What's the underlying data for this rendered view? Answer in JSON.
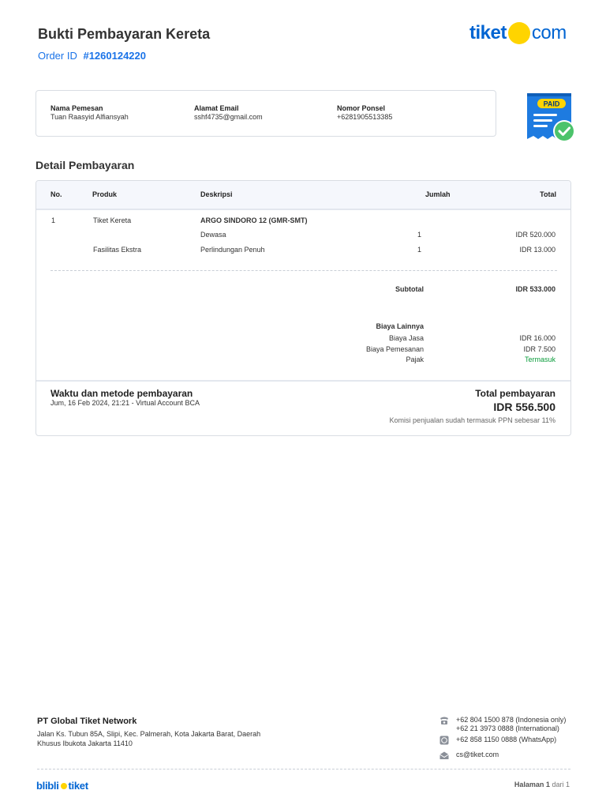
{
  "header": {
    "title": "Bukti Pembayaran Kereta",
    "order_label": "Order ID",
    "order_id": "#1260124220"
  },
  "logo": {
    "left": "tiket",
    "right": "com"
  },
  "customer": {
    "name_label": "Nama Pemesan",
    "name": "Tuan Raasyid Alfiansyah",
    "email_label": "Alamat Email",
    "email": "sshf4735@gmail.com",
    "phone_label": "Nomor Ponsel",
    "phone": "+6281905513385"
  },
  "badge": {
    "text": "PAID"
  },
  "detail": {
    "title": "Detail Pembayaran",
    "columns": {
      "no": "No.",
      "product": "Produk",
      "description": "Deskripsi",
      "qty": "Jumlah",
      "total": "Total"
    },
    "rows": [
      {
        "no": "1",
        "product": "Tiket Kereta",
        "description": "ARGO SINDORO 12 (GMR-SMT)",
        "qty": "",
        "total": ""
      },
      {
        "no": "",
        "product": "",
        "description": "Dewasa",
        "qty": "1",
        "total": "IDR 520.000"
      },
      {
        "no": "",
        "product": "Fasilitas Ekstra",
        "description": "Perlindungan Penuh",
        "qty": "1",
        "total": "IDR 13.000"
      }
    ],
    "subtotal_label": "Subtotal",
    "subtotal": "IDR 533.000",
    "other_fees_label": "Biaya Lainnya",
    "fees": [
      {
        "label": "Biaya Jasa",
        "value": "IDR 16.000"
      },
      {
        "label": "Biaya Pemesanan",
        "value": "IDR 7.500"
      },
      {
        "label": "Pajak",
        "value": "Termasuk"
      }
    ],
    "payment_time_label": "Waktu dan metode pembayaran",
    "payment_time": "Jum, 16 Feb 2024, 21:21 - Virtual Account BCA",
    "total_label": "Total pembayaran",
    "total": "IDR 556.500",
    "note": "Komisi penjualan sudah termasuk PPN sebesar 11%"
  },
  "footer": {
    "company": "PT Global Tiket Network",
    "address": "Jalan Ks. Tubun 85A, Slipi, Kec. Palmerah, Kota Jakarta Barat, Daerah Khusus Ibukota Jakarta 11410",
    "phone_id": "+62 804 1500 878 (Indonesia only)",
    "phone_intl": "+62 21 3973 0888 (International)",
    "whatsapp": "+62 858 1150 0888 (WhatsApp)",
    "email": "cs@tiket.com",
    "brand_left": "blibli",
    "brand_right": "tiket",
    "page_label": "Halaman",
    "page_current": "1",
    "page_sep": "dari",
    "page_total": "1"
  },
  "colors": {
    "brand_blue": "#0064d2",
    "brand_yellow": "#ffd400",
    "link_blue": "#1a73e8",
    "included_green": "#0a9c3b"
  }
}
